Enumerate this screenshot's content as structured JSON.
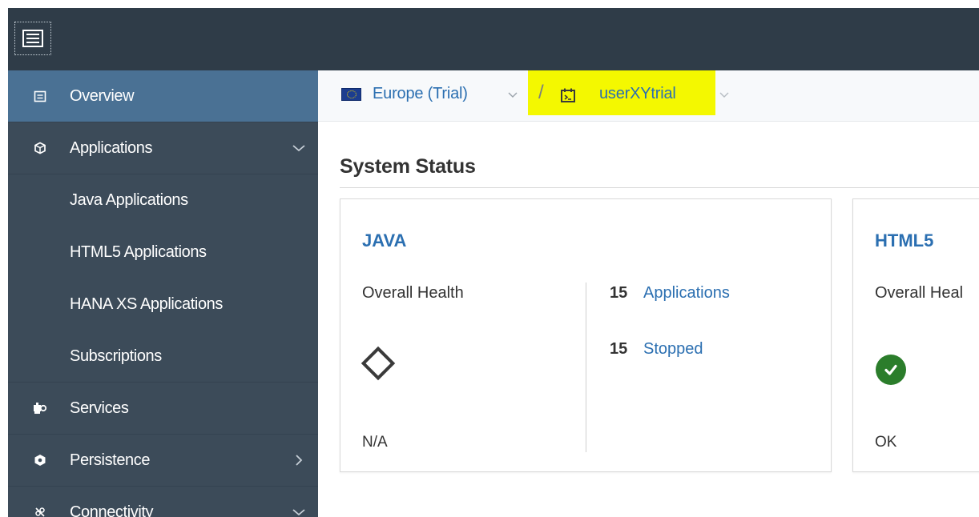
{
  "shellbar": {
    "menu_icon": "hamburger-menu-icon"
  },
  "sidebar": {
    "items": [
      {
        "label": "Overview",
        "icon": "overview-icon",
        "selected": true
      },
      {
        "label": "Applications",
        "icon": "applications-icon",
        "expanded": true,
        "children": [
          "Java Applications",
          "HTML5 Applications",
          "HANA XS Applications",
          "Subscriptions"
        ]
      },
      {
        "label": "Services",
        "icon": "services-icon"
      },
      {
        "label": "Persistence",
        "icon": "persistence-icon",
        "has_children": true
      },
      {
        "label": "Connectivity",
        "icon": "connectivity-icon",
        "expanded": true
      }
    ]
  },
  "breadcrumb": {
    "region": "Europe (Trial)",
    "region_icon": "eu-flag-icon",
    "separator": "/",
    "account": "userXYtrial",
    "account_icon": "subaccount-icon",
    "highlight_color": "#f4f800"
  },
  "main": {
    "section_title": "System Status",
    "tiles": [
      {
        "title": "JAVA",
        "health_label": "Overall Health",
        "health_status": "N/A",
        "health_icon": "diamond-outline-icon",
        "stats": [
          {
            "count": "15",
            "label": "Applications"
          },
          {
            "count": "15",
            "label": "Stopped"
          }
        ]
      },
      {
        "title": "HTML5",
        "health_label": "Overall Heal",
        "health_status": "OK",
        "health_icon": "checkmark-circle-icon",
        "status_color": "#2b7d2b"
      }
    ]
  },
  "colors": {
    "shellbar_bg": "#2f3c48",
    "sidebar_bg": "#3c4b59",
    "sidebar_selected_bg": "#4a7194",
    "link": "#2b6fb1"
  }
}
